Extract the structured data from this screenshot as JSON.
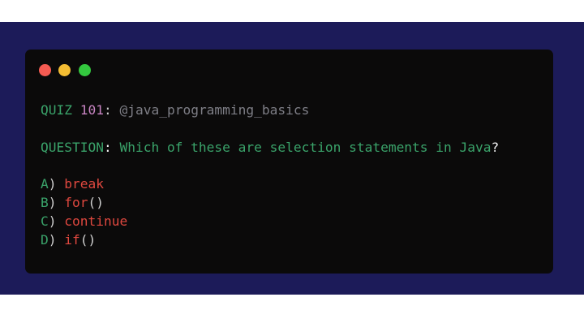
{
  "window": {
    "colors": {
      "background": "#0b0a0a",
      "outer_band": "#1c1b59",
      "close": "#f55b52",
      "minimize": "#f4bd33",
      "maximize": "#34c83f"
    }
  },
  "quiz": {
    "label": "QUIZ",
    "number": "101",
    "colon": ":",
    "handle": "@java_programming_basics"
  },
  "question": {
    "label": "QUESTION",
    "colon": ":",
    "text": " Which of these are selection statements in Java",
    "mark": "?"
  },
  "options": [
    {
      "letter": "A",
      "paren": ")",
      "text": "break",
      "suffix": ""
    },
    {
      "letter": "B",
      "paren": ")",
      "text": "for",
      "suffix": "()"
    },
    {
      "letter": "C",
      "paren": ")",
      "text": "continue",
      "suffix": ""
    },
    {
      "letter": "D",
      "paren": ")",
      "text": "if",
      "suffix": "()"
    }
  ]
}
